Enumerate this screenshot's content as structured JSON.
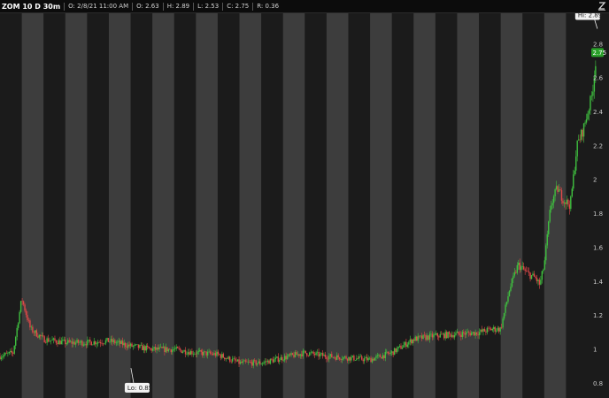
{
  "header": {
    "symbol": "ZOM 10 D 30m",
    "open": "O: 2/8/21 11:00 AM",
    "fields": [
      "O: 2.63",
      "H: 2.89",
      "L: 2.53",
      "C: 2.75",
      "R: 0.36"
    ],
    "zoom_icon": "zoom-icon"
  },
  "chart_data": {
    "type": "candlestick",
    "title": "",
    "xlabel": "",
    "ylabel": "",
    "ylim": [
      0.75,
      2.95
    ],
    "yticks": [
      "2.8",
      "2.6",
      "2.4",
      "2.2",
      "2",
      "1.8",
      "1.6",
      "1.4",
      "1.2",
      "1",
      "0.8"
    ],
    "ytick_values": [
      2.8,
      2.6,
      2.4,
      2.2,
      2.0,
      1.8,
      1.6,
      1.4,
      1.2,
      1.0,
      0.8
    ],
    "last_price": "2.75",
    "last_value": 2.75,
    "high_label": "Hi: 2.89",
    "high_value": 2.89,
    "low_label": "Lo: 0.85",
    "low_value": 0.85,
    "sessions": 27,
    "colors": {
      "up": "#3fbf3f",
      "down": "#e04848",
      "band_dark": "#1b1b1b",
      "band_light": "#3d3d3d",
      "last_badge": "#2aa02a"
    },
    "price_path": [
      [
        0,
        0.96
      ],
      [
        0.6,
        0.98
      ],
      [
        1.0,
        1.3
      ],
      [
        1.4,
        1.12
      ],
      [
        2.0,
        1.06
      ],
      [
        3,
        1.04
      ],
      [
        4,
        1.04
      ],
      [
        5,
        1.05
      ],
      [
        6,
        1.02
      ],
      [
        7,
        1.0
      ],
      [
        8,
        1.0
      ],
      [
        9,
        0.98
      ],
      [
        10,
        0.97
      ],
      [
        11,
        0.92
      ],
      [
        12,
        0.92
      ],
      [
        13,
        0.95
      ],
      [
        14,
        0.98
      ],
      [
        15,
        0.96
      ],
      [
        16,
        0.95
      ],
      [
        17,
        0.94
      ],
      [
        18,
        0.98
      ],
      [
        19,
        1.06
      ],
      [
        20,
        1.08
      ],
      [
        21,
        1.09
      ],
      [
        22,
        1.1
      ],
      [
        22.6,
        1.12
      ],
      [
        23.0,
        1.12
      ],
      [
        23.4,
        1.35
      ],
      [
        23.8,
        1.5
      ],
      [
        24.2,
        1.45
      ],
      [
        24.6,
        1.42
      ],
      [
        24.8,
        1.38
      ],
      [
        25.0,
        1.5
      ],
      [
        25.3,
        1.85
      ],
      [
        25.6,
        1.95
      ],
      [
        25.9,
        1.88
      ],
      [
        26.2,
        1.85
      ],
      [
        26.5,
        2.2
      ],
      [
        26.8,
        2.3
      ],
      [
        27.0,
        2.4
      ],
      [
        27.2,
        2.5
      ],
      [
        27.4,
        2.75
      ]
    ]
  }
}
